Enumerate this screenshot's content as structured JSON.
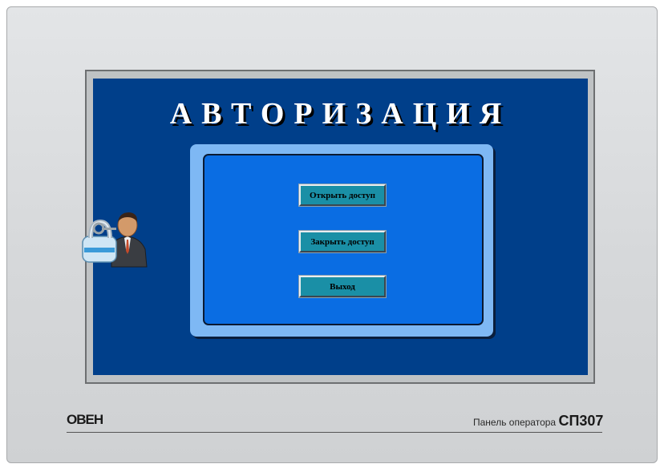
{
  "screen": {
    "title": "АВТОРИЗАЦИЯ",
    "background_color": "#003f8a",
    "buttons": [
      {
        "label": "Открыть доступ"
      },
      {
        "label": "Закрыть доступ"
      },
      {
        "label": "Выход"
      }
    ],
    "icon": "user-with-padlock-icon"
  },
  "branding": {
    "logo": "ОВЕН",
    "panel_label": "Панель оператора",
    "model": "СП307"
  }
}
